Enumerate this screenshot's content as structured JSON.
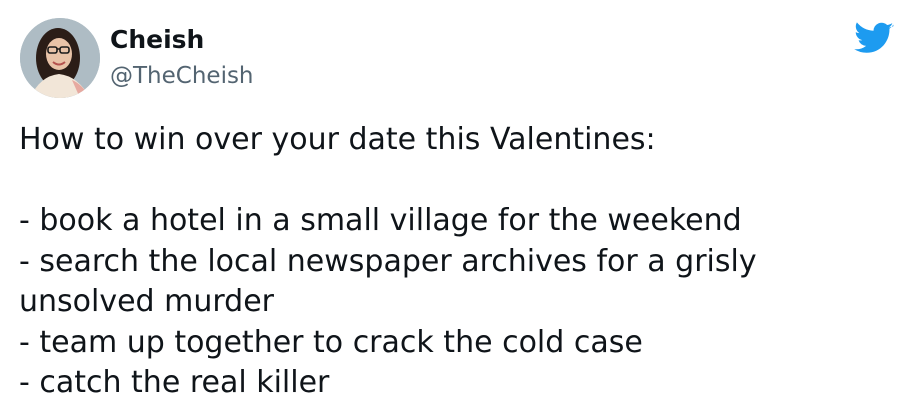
{
  "tweet": {
    "author": {
      "display_name": "Cheish",
      "handle": "@TheCheish"
    },
    "icons": {
      "brand": "twitter-bird-icon",
      "avatar": "profile-photo"
    },
    "colors": {
      "brand": "#1d9bf0",
      "handle": "#536471",
      "text": "#0f1419"
    },
    "text_lines": [
      "How to win over your date this Valentines:",
      "",
      "- book a hotel in a small village for the weekend",
      "- search the local newspaper archives for a grisly",
      "unsolved murder",
      "- team up together to crack the cold case",
      "- catch the real killer"
    ]
  }
}
